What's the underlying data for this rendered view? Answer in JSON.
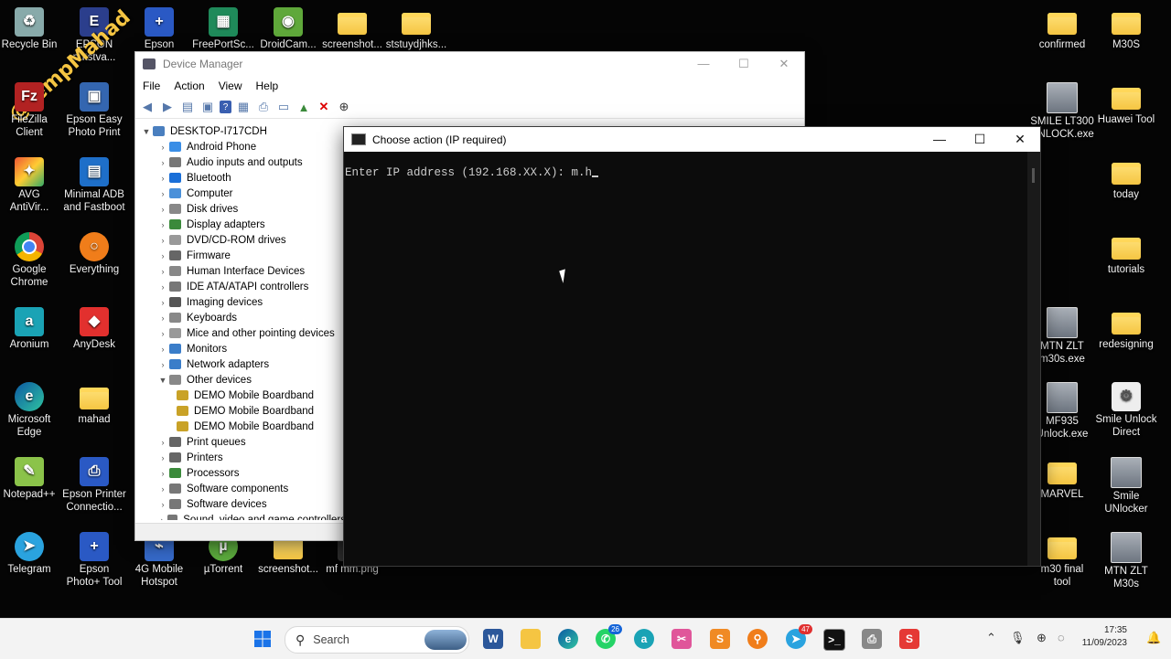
{
  "desktop": {
    "watermark": "@tempMahad",
    "icons": [
      {
        "label": "Recycle Bin",
        "x": 0
      },
      {
        "label": "EPSON\nputstva...",
        "x": 1
      },
      {
        "label": "Epson",
        "x": 2
      },
      {
        "label": "FreePortSc...",
        "x": 3
      },
      {
        "label": "DroidCam...",
        "x": 4
      },
      {
        "label": "screenshot...",
        "x": 5
      },
      {
        "label": "ststuydjhks...",
        "x": 6
      },
      {
        "label": "FileZilla\nClient",
        "x": 7
      },
      {
        "label": "Epson Easy\nPhoto Print",
        "x": 8
      },
      {
        "label": "AVG\nAntiVir...",
        "x": 9
      },
      {
        "label": "Minimal ADB\nand Fastboot",
        "x": 10
      },
      {
        "label": "Google\nChrome",
        "x": 11
      },
      {
        "label": "Everything",
        "x": 12
      },
      {
        "label": "Aronium",
        "x": 13
      },
      {
        "label": "AnyDesk",
        "x": 14
      },
      {
        "label": "Microsoft\nEdge",
        "x": 15
      },
      {
        "label": "mahad",
        "x": 16
      },
      {
        "label": "Notepad++",
        "x": 17
      },
      {
        "label": "Epson Printer\nConnectio...",
        "x": 18
      },
      {
        "label": "Telegram",
        "x": 19
      },
      {
        "label": "Epson\nPhoto+ Tool",
        "x": 20
      },
      {
        "label": "4G Mobile\nHotspot",
        "x": 21
      },
      {
        "label": "µTorrent",
        "x": 22
      },
      {
        "label": "screenshot...",
        "x": 23
      },
      {
        "label": "mf mm.png",
        "x": 24
      },
      {
        "label": "confirmed",
        "x": 25
      },
      {
        "label": "M30S",
        "x": 26
      },
      {
        "label": "SMILE LT300\nUNLOCK.exe",
        "x": 27
      },
      {
        "label": "Huawei Tool",
        "x": 28
      },
      {
        "label": "today",
        "x": 29
      },
      {
        "label": "tutorials",
        "x": 30
      },
      {
        "label": "MTN ZLT\nm30s.exe",
        "x": 31
      },
      {
        "label": "redesigning",
        "x": 32
      },
      {
        "label": "MF935\nUnlock.exe",
        "x": 33
      },
      {
        "label": "Smile Unlock\nDirect",
        "x": 34
      },
      {
        "label": "MARVEL",
        "x": 35
      },
      {
        "label": "Smile\nUNlocker",
        "x": 36
      },
      {
        "label": "m30 final\ntool",
        "x": 37
      },
      {
        "label": "MTN ZLT\nM30s",
        "x": 38
      }
    ]
  },
  "device_manager": {
    "title": "Device Manager",
    "menu": [
      "File",
      "Action",
      "View",
      "Help"
    ],
    "root": "DESKTOP-I717CDH",
    "items": [
      {
        "label": "Android Phone",
        "expanded": false,
        "color": "#3a8ee6"
      },
      {
        "label": "Audio inputs and outputs",
        "expanded": false,
        "color": "#777"
      },
      {
        "label": "Bluetooth",
        "expanded": false,
        "color": "#1a6fd8"
      },
      {
        "label": "Computer",
        "expanded": false,
        "color": "#4a90d9"
      },
      {
        "label": "Disk drives",
        "expanded": false,
        "color": "#888"
      },
      {
        "label": "Display adapters",
        "expanded": false,
        "color": "#3b8a3b"
      },
      {
        "label": "DVD/CD-ROM drives",
        "expanded": false,
        "color": "#999"
      },
      {
        "label": "Firmware",
        "expanded": false,
        "color": "#666"
      },
      {
        "label": "Human Interface Devices",
        "expanded": false,
        "color": "#888"
      },
      {
        "label": "IDE ATA/ATAPI controllers",
        "expanded": false,
        "color": "#777"
      },
      {
        "label": "Imaging devices",
        "expanded": false,
        "color": "#555"
      },
      {
        "label": "Keyboards",
        "expanded": false,
        "color": "#888"
      },
      {
        "label": "Mice and other pointing devices",
        "expanded": false,
        "color": "#999"
      },
      {
        "label": "Monitors",
        "expanded": false,
        "color": "#3a7dc9"
      },
      {
        "label": "Network adapters",
        "expanded": false,
        "color": "#3a7dc9"
      },
      {
        "label": "Other devices",
        "expanded": true,
        "color": "#888"
      },
      {
        "label": "DEMO Mobile Boardband",
        "child": true,
        "color": "#c9a227"
      },
      {
        "label": "DEMO Mobile Boardband",
        "child": true,
        "color": "#c9a227"
      },
      {
        "label": "DEMO Mobile Boardband",
        "child": true,
        "color": "#c9a227"
      },
      {
        "label": "Print queues",
        "expanded": false,
        "color": "#666"
      },
      {
        "label": "Printers",
        "expanded": false,
        "color": "#666"
      },
      {
        "label": "Processors",
        "expanded": false,
        "color": "#3b8a3b"
      },
      {
        "label": "Software components",
        "expanded": false,
        "color": "#777"
      },
      {
        "label": "Software devices",
        "expanded": false,
        "color": "#777"
      },
      {
        "label": "Sound, video and game controllers",
        "expanded": false,
        "color": "#777"
      }
    ]
  },
  "console": {
    "title": "Choose action (IP required)",
    "prompt": "Enter IP address (192.168.XX.X): m.h"
  },
  "taskbar": {
    "search_label": "Search",
    "whatsapp_badge": "26",
    "other_badge": "47",
    "time": "17:35",
    "date": "11/09/2023"
  },
  "colors": {
    "console_bg": "#0c0c0c",
    "console_text": "#cccccc",
    "desktop_bg": "#050505",
    "taskbar_bg": "#f3f3f3"
  }
}
